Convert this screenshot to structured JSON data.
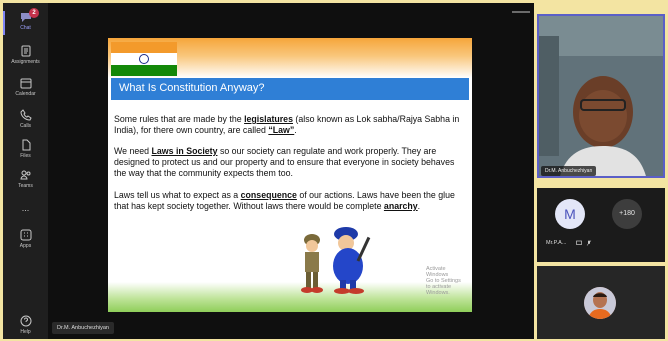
{
  "rail": {
    "items": [
      {
        "label": "Chat",
        "icon": "chat-icon",
        "badge": "2",
        "active": true
      },
      {
        "label": "Assignments",
        "icon": "assignments-icon"
      },
      {
        "label": "Calendar",
        "icon": "calendar-icon"
      },
      {
        "label": "Calls",
        "icon": "calls-icon"
      },
      {
        "label": "Files",
        "icon": "files-icon"
      },
      {
        "label": "Teams",
        "icon": "teams-icon"
      },
      {
        "label": "...",
        "icon": "more-icon"
      },
      {
        "label": "Apps",
        "icon": "apps-icon"
      },
      {
        "label": "Help",
        "icon": "help-icon"
      }
    ]
  },
  "slide": {
    "title": "What Is Constitution Anyway?",
    "p1": {
      "a": "Some rules that are made by the ",
      "b": "legislatures",
      "c": " (also known as Lok sabha/Rajya Sabha in India), for there own country, are called ",
      "d": "“Law”",
      "e": "."
    },
    "p2": {
      "a": "We need ",
      "b": "Laws in Society",
      "c": " so our society can regulate and work properly. They are designed to protect us and our property and to ensure that everyone in society behaves the way that the community expects them too."
    },
    "p3": {
      "a": "Laws tell us what to expect as a ",
      "b": "consequence",
      "c": " of our actions. Laws have been the glue that has kept society together. Without laws there would be complete ",
      "d": "anarchy",
      "e": "."
    },
    "watermark_line1": "Activate Windows",
    "watermark_line2": "Go to Settings to activate Windows."
  },
  "presenter_label": "Dr.M. Anbuchezhiyan",
  "camera": {
    "name": "Dr.M. Anbuchezhiyan"
  },
  "participants": {
    "avatar_initial": "M",
    "more_count": "+180",
    "name_short": "Mr.P.A..."
  },
  "colors": {
    "accent": "#5b5fc7",
    "slide_title_bar": "#2f7fd6",
    "page_border": "#f3e4a2"
  }
}
